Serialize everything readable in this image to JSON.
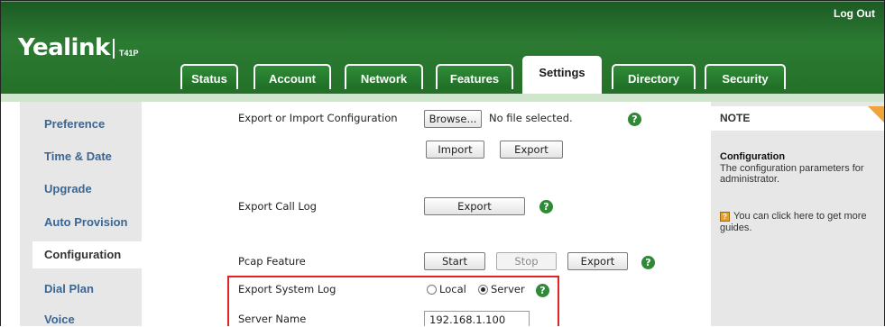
{
  "header": {
    "logo": "Yealink",
    "model": "T41P",
    "logout": "Log Out"
  },
  "tabs": [
    {
      "label": "Status",
      "active": false
    },
    {
      "label": "Account",
      "active": false
    },
    {
      "label": "Network",
      "active": false
    },
    {
      "label": "Features",
      "active": false
    },
    {
      "label": "Settings",
      "active": true
    },
    {
      "label": "Directory",
      "active": false
    },
    {
      "label": "Security",
      "active": false
    }
  ],
  "sidebar": {
    "items": [
      {
        "label": "Preference",
        "active": false
      },
      {
        "label": "Time & Date",
        "active": false
      },
      {
        "label": "Upgrade",
        "active": false
      },
      {
        "label": "Auto Provision",
        "active": false
      },
      {
        "label": "Configuration",
        "active": true
      },
      {
        "label": "Dial Plan",
        "active": false
      },
      {
        "label": "Voice",
        "active": false
      }
    ]
  },
  "config": {
    "export_import_label": "Export or Import Configuration",
    "browse_button": "Browse...",
    "file_status": "No file selected.",
    "import_button": "Import",
    "export_button": "Export",
    "export_call_log_label": "Export Call Log",
    "call_log_export_button": "Export",
    "pcap_label": "Pcap Feature",
    "pcap_start": "Start",
    "pcap_stop": "Stop",
    "pcap_export": "Export",
    "syslog_label": "Export System Log",
    "syslog_local": "Local",
    "syslog_server": "Server",
    "syslog_selected": "Server",
    "server_name_label": "Server Name",
    "server_name_value": "192.168.1.100",
    "help_glyph": "?"
  },
  "note": {
    "title": "NOTE",
    "subtitle": "Configuration",
    "text": "The configuration parameters for administrator.",
    "guide_text": "You can click here to get more guides.",
    "guide_icon": "?",
    "accent_color": "#f0a33a"
  },
  "colors": {
    "header_green": "#2c7b33",
    "sidebar_link": "#3b6691",
    "highlight_box": "#e02424"
  }
}
